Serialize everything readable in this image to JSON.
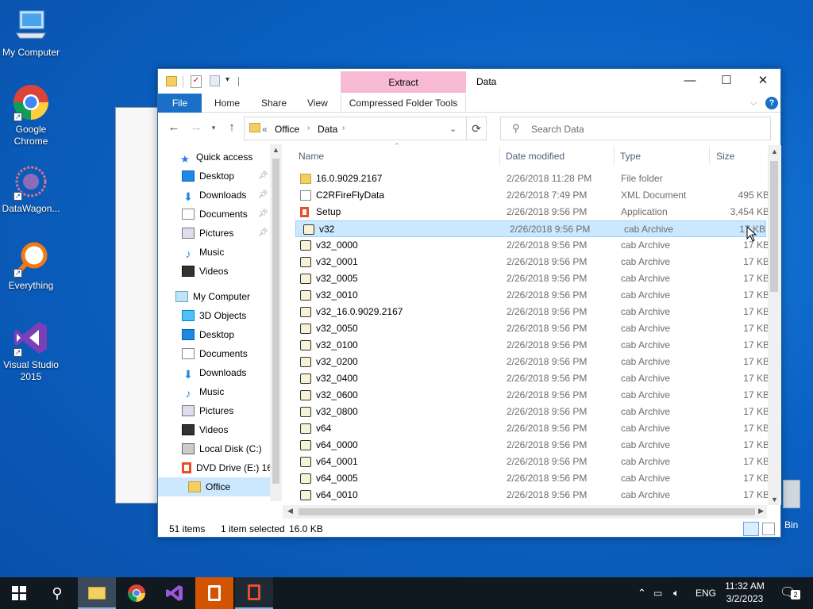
{
  "desktop": {
    "icons": [
      {
        "label": "My Computer"
      },
      {
        "label": "Google Chrome"
      },
      {
        "label": "DataWagon..."
      },
      {
        "label": "Everything"
      },
      {
        "label": "Visual Studio 2015"
      }
    ],
    "recycle_label": "Bin"
  },
  "window": {
    "title": "Data",
    "context_tab": "Extract",
    "context_group": "Compressed Folder Tools",
    "ribbon_tabs": [
      "File",
      "Home",
      "Share",
      "View"
    ],
    "breadcrumb": [
      "Office",
      "Data"
    ],
    "breadcrumb_prefix": "«",
    "search_placeholder": "Search Data",
    "columns": {
      "name": "Name",
      "date": "Date modified",
      "type": "Type",
      "size": "Size"
    },
    "nav": [
      {
        "label": "Quick access",
        "icon": "star-icon"
      },
      {
        "label": "Desktop",
        "icon": "desktop-icon",
        "pinned": true
      },
      {
        "label": "Downloads",
        "icon": "download-icon",
        "pinned": true
      },
      {
        "label": "Documents",
        "icon": "document-icon",
        "pinned": true
      },
      {
        "label": "Pictures",
        "icon": "picture-icon",
        "pinned": true
      },
      {
        "label": "Music",
        "icon": "music-icon"
      },
      {
        "label": "Videos",
        "icon": "video-icon"
      },
      {
        "label": "My Computer",
        "icon": "computer-icon"
      },
      {
        "label": "3D Objects",
        "icon": "cube-icon"
      },
      {
        "label": "Desktop",
        "icon": "desktop-icon"
      },
      {
        "label": "Documents",
        "icon": "document-icon"
      },
      {
        "label": "Downloads",
        "icon": "download-icon"
      },
      {
        "label": "Music",
        "icon": "music-icon"
      },
      {
        "label": "Pictures",
        "icon": "picture-icon"
      },
      {
        "label": "Videos",
        "icon": "video-icon"
      },
      {
        "label": "Local Disk (C:)",
        "icon": "drive-icon"
      },
      {
        "label": "DVD Drive (E:) 16",
        "icon": "office-icon"
      },
      {
        "label": "Office",
        "icon": "folder-icon",
        "selected": true
      }
    ],
    "files": [
      {
        "name": "16.0.9029.2167",
        "date": "2/26/2018 11:28 PM",
        "type": "File folder",
        "size": "",
        "icon": "folder-icon"
      },
      {
        "name": "C2RFireFlyData",
        "date": "2/26/2018 7:49 PM",
        "type": "XML Document",
        "size": "495 KB",
        "icon": "xml-icon"
      },
      {
        "name": "Setup",
        "date": "2/26/2018 9:56 PM",
        "type": "Application",
        "size": "3,454 KB",
        "icon": "office-icon"
      },
      {
        "name": "v32",
        "date": "2/26/2018 9:56 PM",
        "type": "cab Archive",
        "size": "17 KB",
        "icon": "cab-icon",
        "selected": true
      },
      {
        "name": "v32_0000",
        "date": "2/26/2018 9:56 PM",
        "type": "cab Archive",
        "size": "17 KB",
        "icon": "cab-icon"
      },
      {
        "name": "v32_0001",
        "date": "2/26/2018 9:56 PM",
        "type": "cab Archive",
        "size": "17 KB",
        "icon": "cab-icon"
      },
      {
        "name": "v32_0005",
        "date": "2/26/2018 9:56 PM",
        "type": "cab Archive",
        "size": "17 KB",
        "icon": "cab-icon"
      },
      {
        "name": "v32_0010",
        "date": "2/26/2018 9:56 PM",
        "type": "cab Archive",
        "size": "17 KB",
        "icon": "cab-icon"
      },
      {
        "name": "v32_16.0.9029.2167",
        "date": "2/26/2018 9:56 PM",
        "type": "cab Archive",
        "size": "17 KB",
        "icon": "cab-icon"
      },
      {
        "name": "v32_0050",
        "date": "2/26/2018 9:56 PM",
        "type": "cab Archive",
        "size": "17 KB",
        "icon": "cab-icon"
      },
      {
        "name": "v32_0100",
        "date": "2/26/2018 9:56 PM",
        "type": "cab Archive",
        "size": "17 KB",
        "icon": "cab-icon"
      },
      {
        "name": "v32_0200",
        "date": "2/26/2018 9:56 PM",
        "type": "cab Archive",
        "size": "17 KB",
        "icon": "cab-icon"
      },
      {
        "name": "v32_0400",
        "date": "2/26/2018 9:56 PM",
        "type": "cab Archive",
        "size": "17 KB",
        "icon": "cab-icon"
      },
      {
        "name": "v32_0600",
        "date": "2/26/2018 9:56 PM",
        "type": "cab Archive",
        "size": "17 KB",
        "icon": "cab-icon"
      },
      {
        "name": "v32_0800",
        "date": "2/26/2018 9:56 PM",
        "type": "cab Archive",
        "size": "17 KB",
        "icon": "cab-icon"
      },
      {
        "name": "v64",
        "date": "2/26/2018 9:56 PM",
        "type": "cab Archive",
        "size": "17 KB",
        "icon": "cab-icon"
      },
      {
        "name": "v64_0000",
        "date": "2/26/2018 9:56 PM",
        "type": "cab Archive",
        "size": "17 KB",
        "icon": "cab-icon"
      },
      {
        "name": "v64_0001",
        "date": "2/26/2018 9:56 PM",
        "type": "cab Archive",
        "size": "17 KB",
        "icon": "cab-icon"
      },
      {
        "name": "v64_0005",
        "date": "2/26/2018 9:56 PM",
        "type": "cab Archive",
        "size": "17 KB",
        "icon": "cab-icon"
      },
      {
        "name": "v64_0010",
        "date": "2/26/2018 9:56 PM",
        "type": "cab Archive",
        "size": "17 KB",
        "icon": "cab-icon"
      }
    ],
    "status": {
      "count": "51 items",
      "selected": "1 item selected",
      "size": "16.0 KB"
    }
  },
  "taskbar": {
    "lang": "ENG",
    "time": "11:32 AM",
    "date": "3/2/2023",
    "notifications": "2"
  },
  "colors": {
    "accent": "#1a6fc6",
    "selection": "#cce8ff",
    "context_tab": "#f8bad3"
  }
}
